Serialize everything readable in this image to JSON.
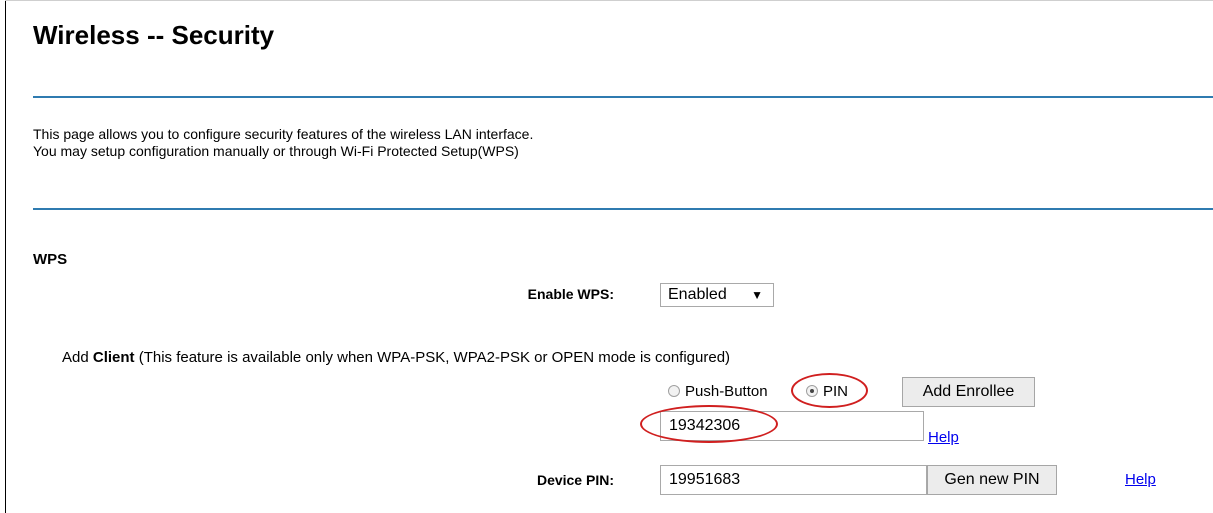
{
  "page": {
    "title": "Wireless -- Security",
    "description_line1": "This page allows you to configure security features of the wireless LAN interface.",
    "description_line2": "You may setup configuration manually or through Wi-Fi Protected Setup(WPS)"
  },
  "wps": {
    "section_title": "WPS",
    "enable_label": "Enable WPS:",
    "enable_value": "Enabled",
    "add_client_prefix": "Add ",
    "add_client_bold": "Client",
    "add_client_note": " (This feature is available only when WPA-PSK, WPA2-PSK or OPEN mode is configured)",
    "push_button_label": "Push-Button",
    "pin_label": "PIN",
    "selected_mode": "PIN",
    "add_enrollee_label": "Add Enrollee",
    "client_pin_value": "19342306",
    "help_label": "Help",
    "device_pin_label": "Device PIN:",
    "device_pin_value": "19951683",
    "gen_pin_label": "Gen new PIN"
  },
  "colors": {
    "rule": "#2f7bb0",
    "highlight": "#d01f1f",
    "link": "#0000ee"
  }
}
